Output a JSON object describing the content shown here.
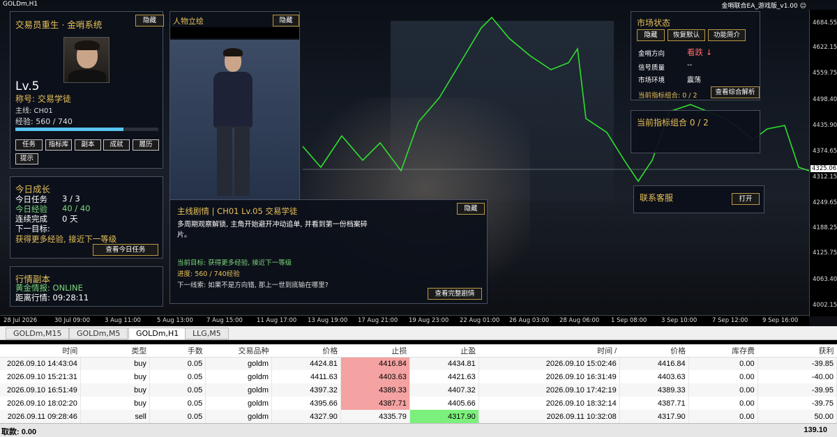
{
  "window": {
    "symbol_label": "GOLDm,H1",
    "ea_label": "金哨联合EA_游戏版_v1.00 ☺"
  },
  "chart_data": {
    "type": "line",
    "symbol": "GOLDm",
    "timeframe": "H1",
    "current_price": "4325.06",
    "y_ticks": [
      "4684.55",
      "4622.15",
      "4559.75",
      "4498.40",
      "4435.90",
      "4374.65",
      "4312.15",
      "4249.65",
      "4188.25",
      "4125.75",
      "4063.40",
      "4002.15"
    ],
    "x_ticks": [
      "28 Jul 2026",
      "30 Jul 09:00",
      "3 Aug 11:00",
      "5 Aug 13:00",
      "7 Aug 15:00",
      "11 Aug 17:00",
      "13 Aug 19:00",
      "17 Aug 21:00",
      "19 Aug 23:00",
      "22 Aug 01:00",
      "26 Aug 03:00",
      "28 Aug 06:00",
      "1 Sep 08:00",
      "3 Sep 10:00",
      "7 Sep 12:00",
      "9 Sep 16:00"
    ],
    "ylim": [
      4002.15,
      4684.55
    ],
    "colors": {
      "line": "#2ee02e",
      "bg": "#0c1018"
    }
  },
  "profile": {
    "title": "交易员重生 · 金哨系统",
    "hide": "隐藏",
    "level": "Lv.5",
    "rank": "称号: 交易学徒",
    "chapter": "主线: CH01",
    "exp": "经验: 560 / 740",
    "exp_fraction": 0.757,
    "buttons": [
      "任务",
      "指标库",
      "副本",
      "成就",
      "履历"
    ],
    "hint": "提示"
  },
  "portrait": {
    "title": "人物立绘",
    "hide": "隐藏"
  },
  "growth": {
    "title": "今日成长",
    "tasks_label": "今日任务",
    "tasks_val": "3 / 3",
    "exp_label": "今日经验",
    "exp_val": "40 / 40",
    "streak_label": "连续完成",
    "streak_val": "0 天",
    "next_label": "下一目标:",
    "next_val": "获得更多经验, 接近下一等级",
    "btn": "查看今日任务"
  },
  "dungeon": {
    "title": "行情副本",
    "gold_info": "黄金情报: ONLINE",
    "countdown": "距离行情: 09:28:11"
  },
  "story": {
    "title": "主线剧情 | CH01  Lv.05 交易学徒",
    "hide": "隐藏",
    "text": "多周期观察解锁, 主角开始避开冲动追单, 并看到第一份档案碎片。",
    "goal": "当前目标: 获得更多经验, 接近下一等级",
    "progress": "进度: 560 / 740经验",
    "clue": "下一线索: 如果不是方向错, 那上一世到底输在哪里?",
    "btn": "查看完整剧情"
  },
  "market": {
    "title": "市场状态",
    "btn_hide": "隐藏",
    "btn_reset": "恢复默认",
    "btn_intro": "功能简介",
    "dir_label": "金哨方向",
    "dir_val": "看跌 ↓",
    "quality_label": "信号质量",
    "quality_val": "--",
    "env_label": "市场环境",
    "env_val": "震荡",
    "combo_label": "当前指标组合: 0 / 2",
    "combo_btn": "查看综合解析"
  },
  "combo": {
    "title": "当前指标组合 0 / 2"
  },
  "service": {
    "title": "联系客服",
    "btn": "打开"
  },
  "tabs": [
    "GOLDm,M15",
    "GOLDm,M5",
    "GOLDm,H1",
    "LLG,M5"
  ],
  "orders": {
    "headers": [
      "时间",
      "类型",
      "手数",
      "交易品种",
      "价格",
      "止损",
      "止盈",
      "时间 /",
      "价格",
      "库存费",
      "获利"
    ],
    "rows": [
      [
        "2026.09.10 14:43:04",
        "buy",
        "0.05",
        "goldm",
        "4424.81",
        "4416.84",
        "4434.81",
        "2026.09.10 15:02:46",
        "4416.84",
        "0.00",
        "-39.85"
      ],
      [
        "2026.09.10 15:21:31",
        "buy",
        "0.05",
        "goldm",
        "4411.63",
        "4403.63",
        "4421.63",
        "2026.09.10 16:31:49",
        "4403.63",
        "0.00",
        "-40.00"
      ],
      [
        "2026.09.10 16:51:49",
        "buy",
        "0.05",
        "goldm",
        "4397.32",
        "4389.33",
        "4407.32",
        "2026.09.10 17:42:19",
        "4389.33",
        "0.00",
        "-39.95"
      ],
      [
        "2026.09.10 18:02:20",
        "buy",
        "0.05",
        "goldm",
        "4395.66",
        "4387.71",
        "4405.66",
        "2026.09.10 18:32:14",
        "4387.71",
        "0.00",
        "-39.75"
      ],
      [
        "2026.09.11 09:28:46",
        "sell",
        "0.05",
        "goldm",
        "4327.90",
        "4335.79",
        "4317.90",
        "2026.09.11 10:32:08",
        "4317.90",
        "0.00",
        "50.00"
      ]
    ],
    "footer_label": "取款: 0.00",
    "footer_total": "139.10"
  }
}
